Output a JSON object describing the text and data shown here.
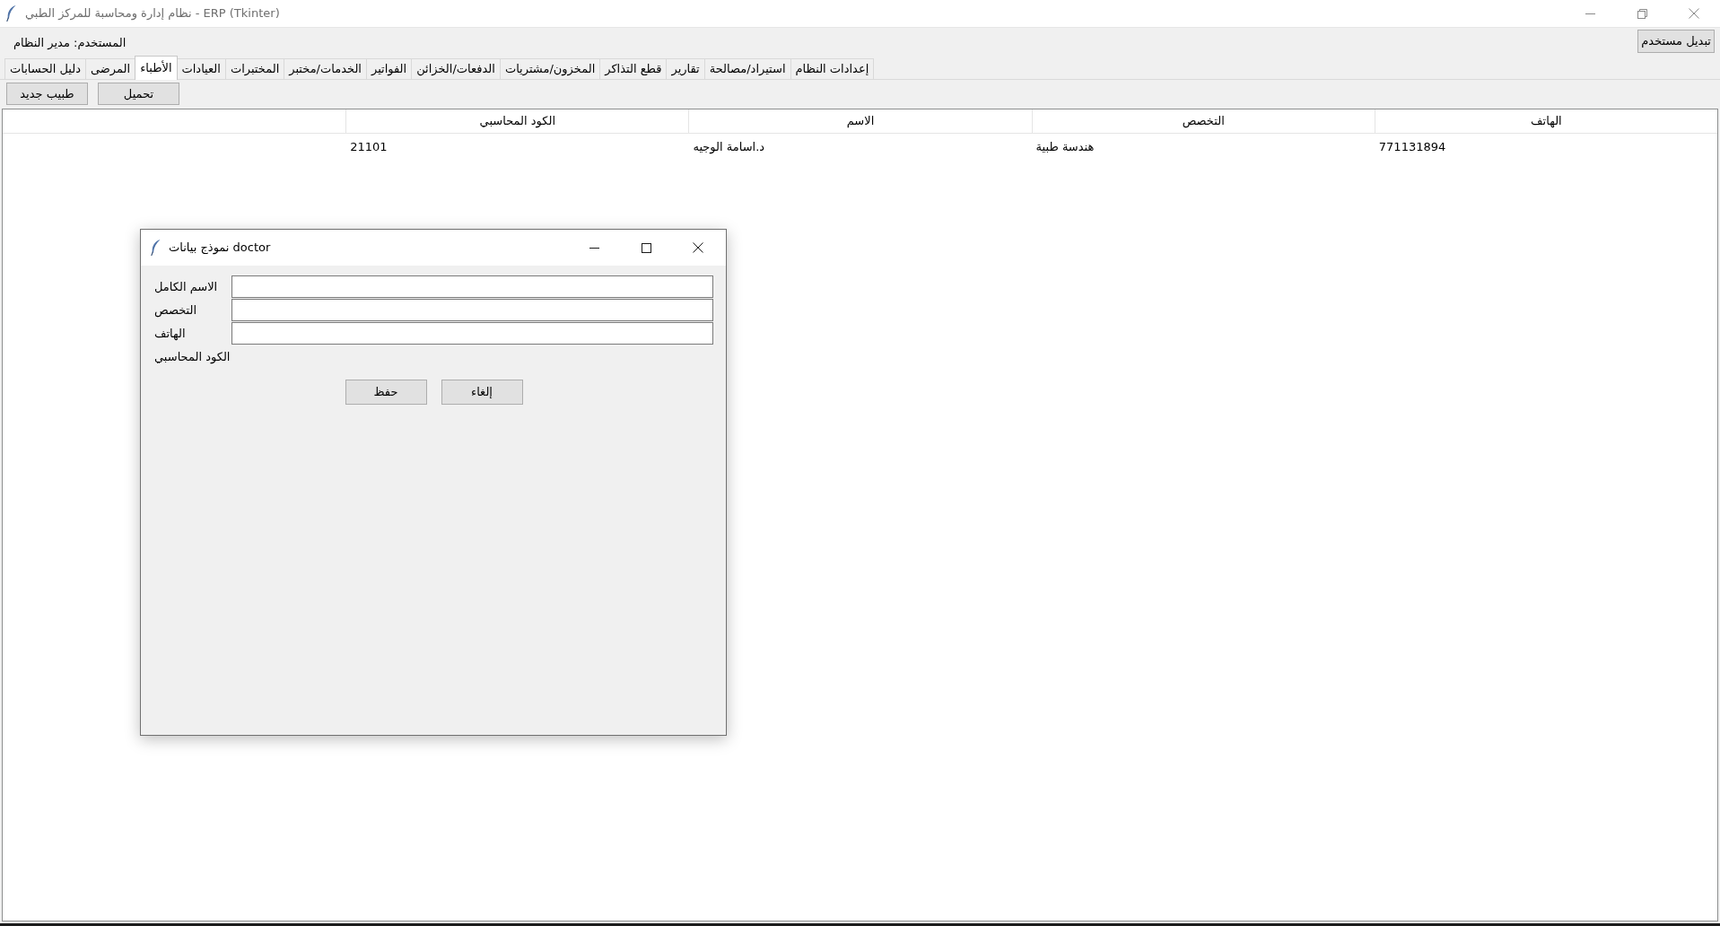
{
  "window": {
    "title": "نظام إدارة ومحاسبة للمركز الطبي - ERP (Tkinter)"
  },
  "user_bar": {
    "user_label": "المستخدم: مدير النظام",
    "switch_button": "تبديل مستخدم"
  },
  "tabs": [
    {
      "label": "إعدادات النظام",
      "selected": false
    },
    {
      "label": "استيراد/مصالحة",
      "selected": false
    },
    {
      "label": "تقارير",
      "selected": false
    },
    {
      "label": "قطع التذاكر",
      "selected": false
    },
    {
      "label": "المخزون/مشتريات",
      "selected": false
    },
    {
      "label": "الدفعات/الخزائن",
      "selected": false
    },
    {
      "label": "الفواتير",
      "selected": false
    },
    {
      "label": "الخدمات/مختبر",
      "selected": false
    },
    {
      "label": "المختبرات",
      "selected": false
    },
    {
      "label": "العيادات",
      "selected": false
    },
    {
      "label": "الأطباء",
      "selected": true
    },
    {
      "label": "المرضى",
      "selected": false
    },
    {
      "label": "دليل الحسابات",
      "selected": false
    }
  ],
  "toolbar": {
    "buttons": [
      "تحميل",
      "طبيب جديد"
    ]
  },
  "table": {
    "columns": [
      "الهاتف",
      "التخصص",
      "الاسم",
      "الكود المحاسبي"
    ],
    "rows": [
      {
        "cells": [
          "771131894",
          "هندسة طبية",
          "د.اسامة الوجيه",
          "21101"
        ]
      }
    ]
  },
  "dialog": {
    "title": "نموذج بيانات doctor",
    "fields": [
      {
        "label": "الاسم الكامل",
        "kind": "entry"
      },
      {
        "label": "التخصص",
        "kind": "entry"
      },
      {
        "label": "الهاتف",
        "kind": "entry"
      },
      {
        "label": "الكود المحاسبي",
        "kind": "plain"
      }
    ],
    "buttons": [
      "إلغاء",
      "حفظ"
    ]
  }
}
